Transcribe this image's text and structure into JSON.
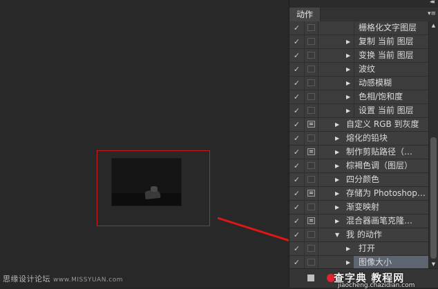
{
  "colors": {
    "selection_rect": "#d11a1a",
    "arrow": "#e01616",
    "record_button": "#e3232f",
    "selected_row": "#5c6570"
  },
  "watermark_left": {
    "text": "思缘设计论坛",
    "url": "www.MISSYUAN.com"
  },
  "watermark_right": {
    "text": "查字典 教程网",
    "url": "jiaocheng.chazidian.com"
  },
  "panel": {
    "collapse_icon": "double-chevron-right-icon",
    "tab_label": "动作",
    "menu_icon": "panel-menu-icon",
    "rows": [
      {
        "kind": "cmd",
        "label": "栅格化文字图层",
        "check": "✓",
        "expand": false,
        "dialog": false
      },
      {
        "kind": "cmd",
        "label": "复制 当前 图层",
        "check": "✓",
        "expand": true,
        "dialog": false
      },
      {
        "kind": "cmd",
        "label": "变换 当前 图层",
        "check": "✓",
        "expand": true,
        "dialog": false
      },
      {
        "kind": "cmd",
        "label": "波纹",
        "check": "✓",
        "expand": true,
        "dialog": false
      },
      {
        "kind": "cmd",
        "label": "动感模糊",
        "check": "✓",
        "expand": true,
        "dialog": false
      },
      {
        "kind": "cmd",
        "label": "色相/饱和度",
        "check": "✓",
        "expand": true,
        "dialog": false
      },
      {
        "kind": "cmd",
        "label": "设置 当前 图层",
        "check": "✓",
        "expand": true,
        "dialog": false
      },
      {
        "kind": "act",
        "label": "自定义 RGB 到灰度",
        "check": "✓",
        "expand": true,
        "dialog": true
      },
      {
        "kind": "act",
        "label": "熔化的铅块",
        "check": "✓",
        "expand": true,
        "dialog": false
      },
      {
        "kind": "act",
        "label": "制作剪贴路径（…",
        "check": "✓",
        "expand": true,
        "dialog": true
      },
      {
        "kind": "act",
        "label": "棕褐色调（图层）",
        "check": "✓",
        "expand": true,
        "dialog": false
      },
      {
        "kind": "act",
        "label": "四分颜色",
        "check": "✓",
        "expand": true,
        "dialog": false
      },
      {
        "kind": "act",
        "label": "存储为 Photoshop…",
        "check": "✓",
        "expand": true,
        "dialog": true
      },
      {
        "kind": "act",
        "label": "渐变映射",
        "check": "✓",
        "expand": true,
        "dialog": false
      },
      {
        "kind": "act",
        "label": "混合器画笔克隆…",
        "check": "✓",
        "expand": true,
        "dialog": true
      },
      {
        "kind": "set",
        "label": "我 的动作",
        "check": "✓",
        "expand": "open",
        "dialog": false
      },
      {
        "kind": "act",
        "label": "打开",
        "check": "✓",
        "expand": true,
        "dialog": false
      },
      {
        "kind": "act",
        "label": "图像大小",
        "check": "✓",
        "expand": true,
        "dialog": false,
        "selected": true
      }
    ],
    "bottom": {
      "stop_icon": "stop-icon",
      "record_icon": "record-icon"
    },
    "scroll": {
      "up_icon": "scroll-up-icon",
      "down_icon": "scroll-down-icon"
    }
  }
}
